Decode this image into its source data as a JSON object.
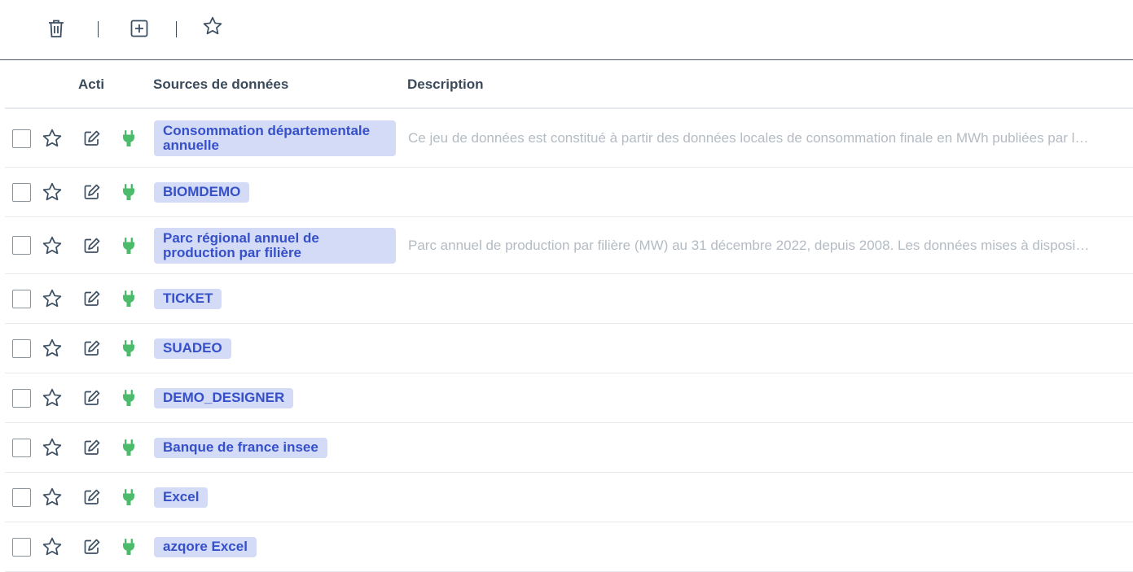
{
  "toolbar": {
    "delete_icon": "trash-icon",
    "add_icon": "plus-square-icon",
    "favorite_icon": "star-icon"
  },
  "table": {
    "columns": {
      "actions": "Acti",
      "sources": "Sources de données",
      "description": "Description"
    },
    "rows": [
      {
        "name": "Consommation départementale annuelle",
        "description": "Ce jeu de données est constitué à partir des données locales de consommation finale en MWh publiées par les gestionnaires de réseaux"
      },
      {
        "name": "BIOMDEMO",
        "description": ""
      },
      {
        "name": "Parc régional annuel de production par filière",
        "description": "Parc annuel de production par filière (MW) au 31 décembre 2022, depuis 2008. Les données mises à disposition"
      },
      {
        "name": "TICKET",
        "description": ""
      },
      {
        "name": "SUADEO",
        "description": ""
      },
      {
        "name": "DEMO_DESIGNER",
        "description": ""
      },
      {
        "name": "Banque de france insee",
        "description": ""
      },
      {
        "name": "Excel",
        "description": ""
      },
      {
        "name": "azqore Excel",
        "description": ""
      }
    ]
  },
  "colors": {
    "chip_bg": "#d4dbf7",
    "chip_text": "#3550c9",
    "plug": "#4cbb6c",
    "icon": "#3d4f63"
  }
}
